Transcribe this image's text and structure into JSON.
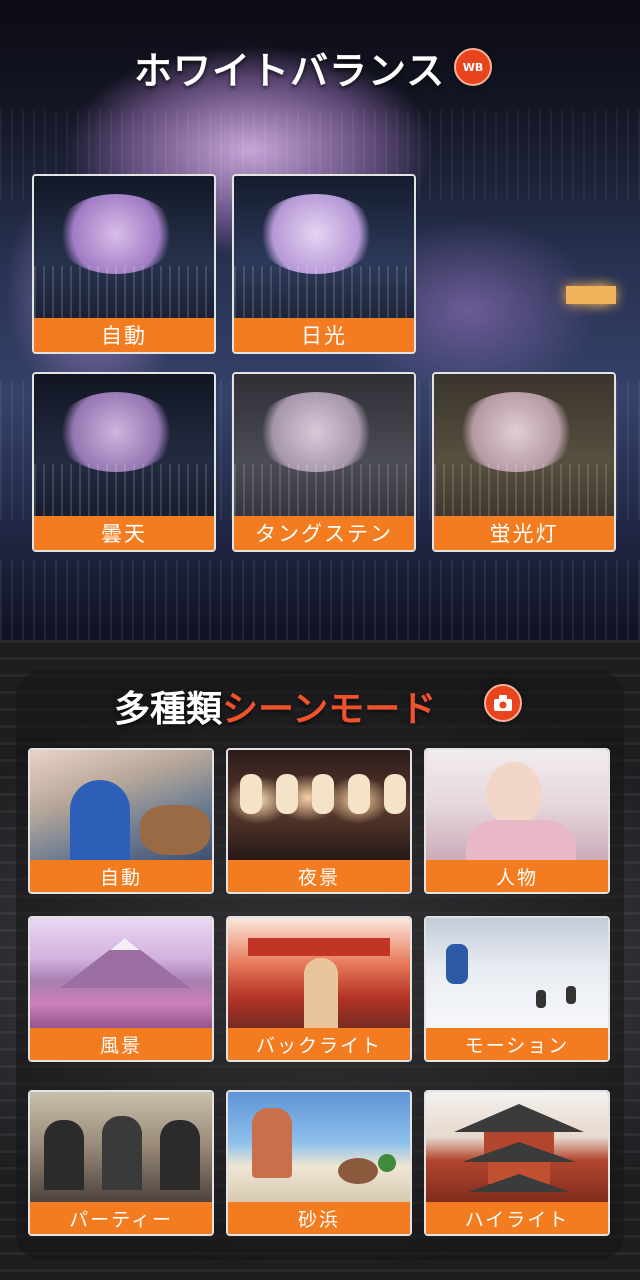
{
  "white_balance": {
    "title": "ホワイトバランス",
    "badge_label": "WB",
    "options": [
      {
        "label": "自動"
      },
      {
        "label": "日光"
      },
      {
        "label": "曇天"
      },
      {
        "label": "タングステン"
      },
      {
        "label": "蛍光灯"
      }
    ]
  },
  "scene_modes": {
    "title_prefix": "多種類",
    "title_accent": "シーンモード",
    "options": [
      {
        "label": "自動"
      },
      {
        "label": "夜景"
      },
      {
        "label": "人物"
      },
      {
        "label": "風景"
      },
      {
        "label": "バックライト"
      },
      {
        "label": "モーション"
      },
      {
        "label": "パーティー"
      },
      {
        "label": "砂浜"
      },
      {
        "label": "ハイライト"
      }
    ]
  },
  "colors": {
    "label_background": "#f47c20",
    "badge": "#e8441e",
    "title_accent": "#f2522b",
    "title": "#ffffff"
  }
}
